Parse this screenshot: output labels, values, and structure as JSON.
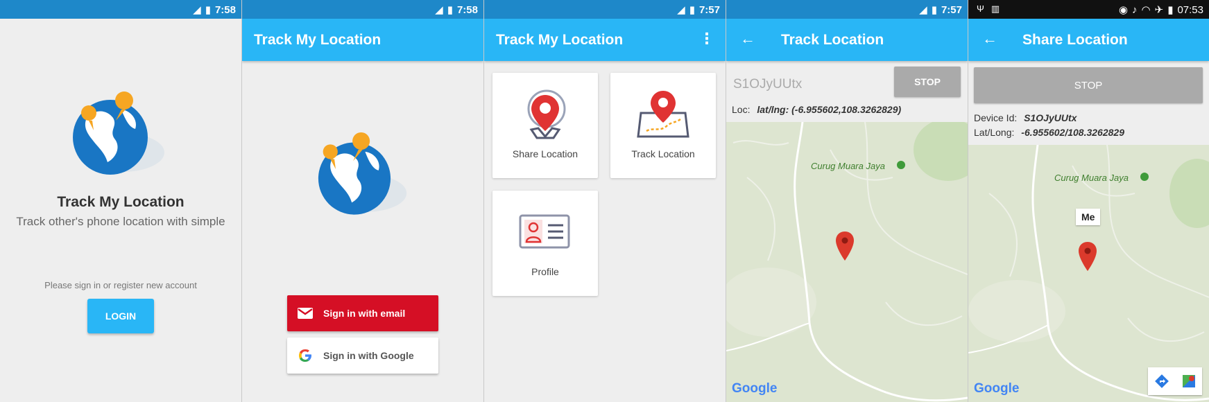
{
  "status": {
    "s1_time": "7:58",
    "s2_time": "7:58",
    "s3_time": "7:57",
    "s4_time": "7:57",
    "s5_time": "07:53"
  },
  "screen1": {
    "title": "Track My Location",
    "subtitle": "Track other's phone location with simple",
    "hint": "Please sign in or register new account",
    "login_label": "LOGIN"
  },
  "screen2": {
    "appbar_title": "Track My Location",
    "email_label": "Sign in with email",
    "google_label": "Sign in with Google"
  },
  "screen3": {
    "appbar_title": "Track My Location",
    "cards": [
      {
        "label": "Share Location"
      },
      {
        "label": "Track Location"
      },
      {
        "label": "Profile"
      }
    ]
  },
  "screen4": {
    "appbar_title": "Track Location",
    "device_input": "S1OJyUUtx",
    "stop_label": "STOP",
    "loc_label": "Loc:",
    "loc_value": "lat/lng: (-6.955602,108.3262829)",
    "place_label": "Curug Muara Jaya"
  },
  "screen5": {
    "appbar_title": "Share Location",
    "stop_label": "STOP",
    "device_id_label": "Device Id:",
    "device_id_value": "S1OJyUUtx",
    "latlong_label": "Lat/Long:",
    "latlong_value": "-6.955602/108.3262829",
    "place_label": "Curug Muara Jaya",
    "marker_label": "Me"
  },
  "map_brand": "Google",
  "colors": {
    "appbar": "#29b6f6",
    "statusbar": "#1e88c9",
    "email_btn": "#d50f25",
    "stop_btn": "#aaaaaa"
  }
}
